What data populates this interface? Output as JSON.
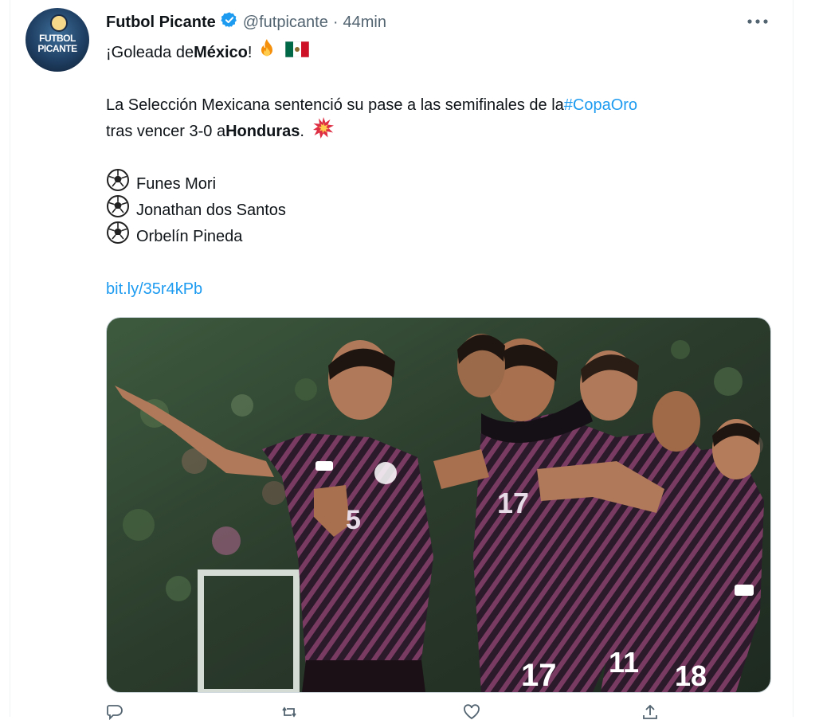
{
  "tweet": {
    "author": {
      "display_name": "Futbol Picante",
      "handle": "@futpicante",
      "separator": "·",
      "time": "44min",
      "avatar_text": "FUTBOL PICANTE"
    },
    "lines": {
      "l1_pre": "¡Goleada de ",
      "l1_bold": "México",
      "l1_post": "!",
      "l2_pre": "La Selección Mexicana sentenció su pase a las semifinales de la ",
      "l2_hashtag": "#CopaOro",
      "l3_pre": "tras vencer 3-0 a ",
      "l3_bold": "Honduras",
      "l3_post": ".",
      "scorer1": "Funes Mori",
      "scorer2": "Jonathan dos Santos",
      "scorer3": "Orbelín Pineda",
      "link": "bit.ly/35r4kPb"
    },
    "media": {
      "jersey_numbers": [
        "5",
        "17",
        "17",
        "11",
        "18"
      ]
    }
  },
  "colors": {
    "text": "#0f1419",
    "secondary": "#536471",
    "link": "#1d9bf0",
    "verified": "#1d9bf0"
  },
  "icons": [
    "verified-icon",
    "more-icon",
    "fire-icon",
    "mexico-flag-icon",
    "collision-icon",
    "soccer-ball-icon",
    "reply-icon",
    "retweet-icon",
    "like-icon",
    "share-icon"
  ]
}
